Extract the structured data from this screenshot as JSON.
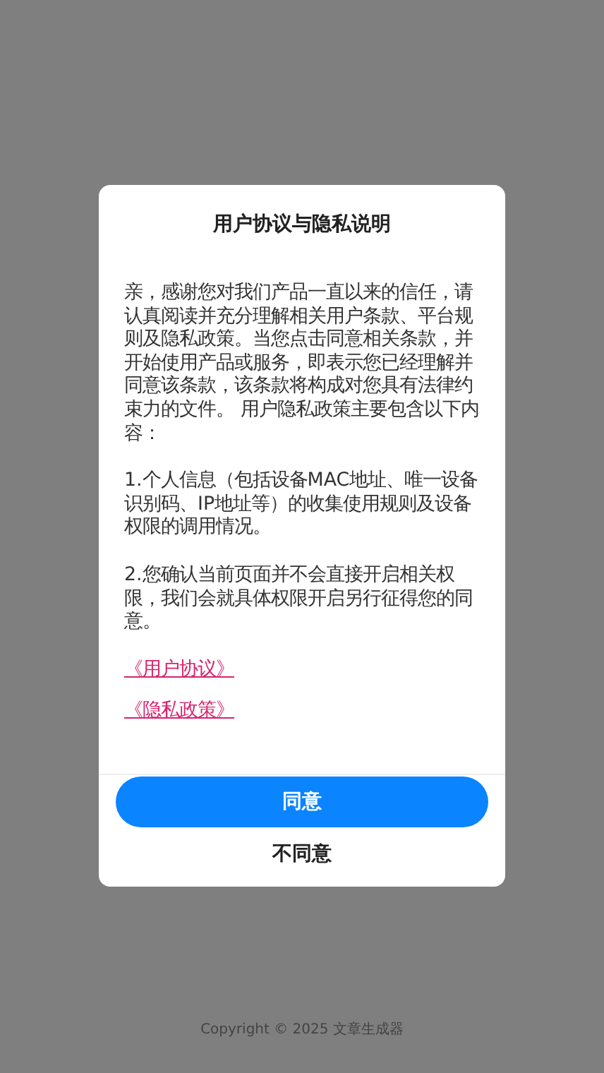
{
  "dialog": {
    "title": "用户协议与隐私说明",
    "paragraphs": [
      "亲，感谢您对我们产品一直以来的信任，请认真阅读并充分理解相关用户条款、平台规则及隐私政策。当您点击同意相关条款，并开始使用产品或服务，即表示您已经理解并同意该条款，该条款将构成对您具有法律约束力的文件。 用户隐私政策主要包含以下内容：",
      "1.个人信息（包括设备MAC地址、唯一设备识别码、IP地址等）的收集使用规则及设备权限的调用情况。",
      "2.您确认当前页面并不会直接开启相关权限，我们会就具体权限开启另行征得您的同意。"
    ],
    "links": [
      "《用户协议》",
      "《隐私政策》"
    ],
    "buttons": [
      {
        "label": "同意",
        "kind": "primary"
      },
      {
        "label": "不同意",
        "kind": "plain"
      }
    ]
  },
  "footer": {
    "copyright": "Copyright © 2025 文章生成器"
  }
}
